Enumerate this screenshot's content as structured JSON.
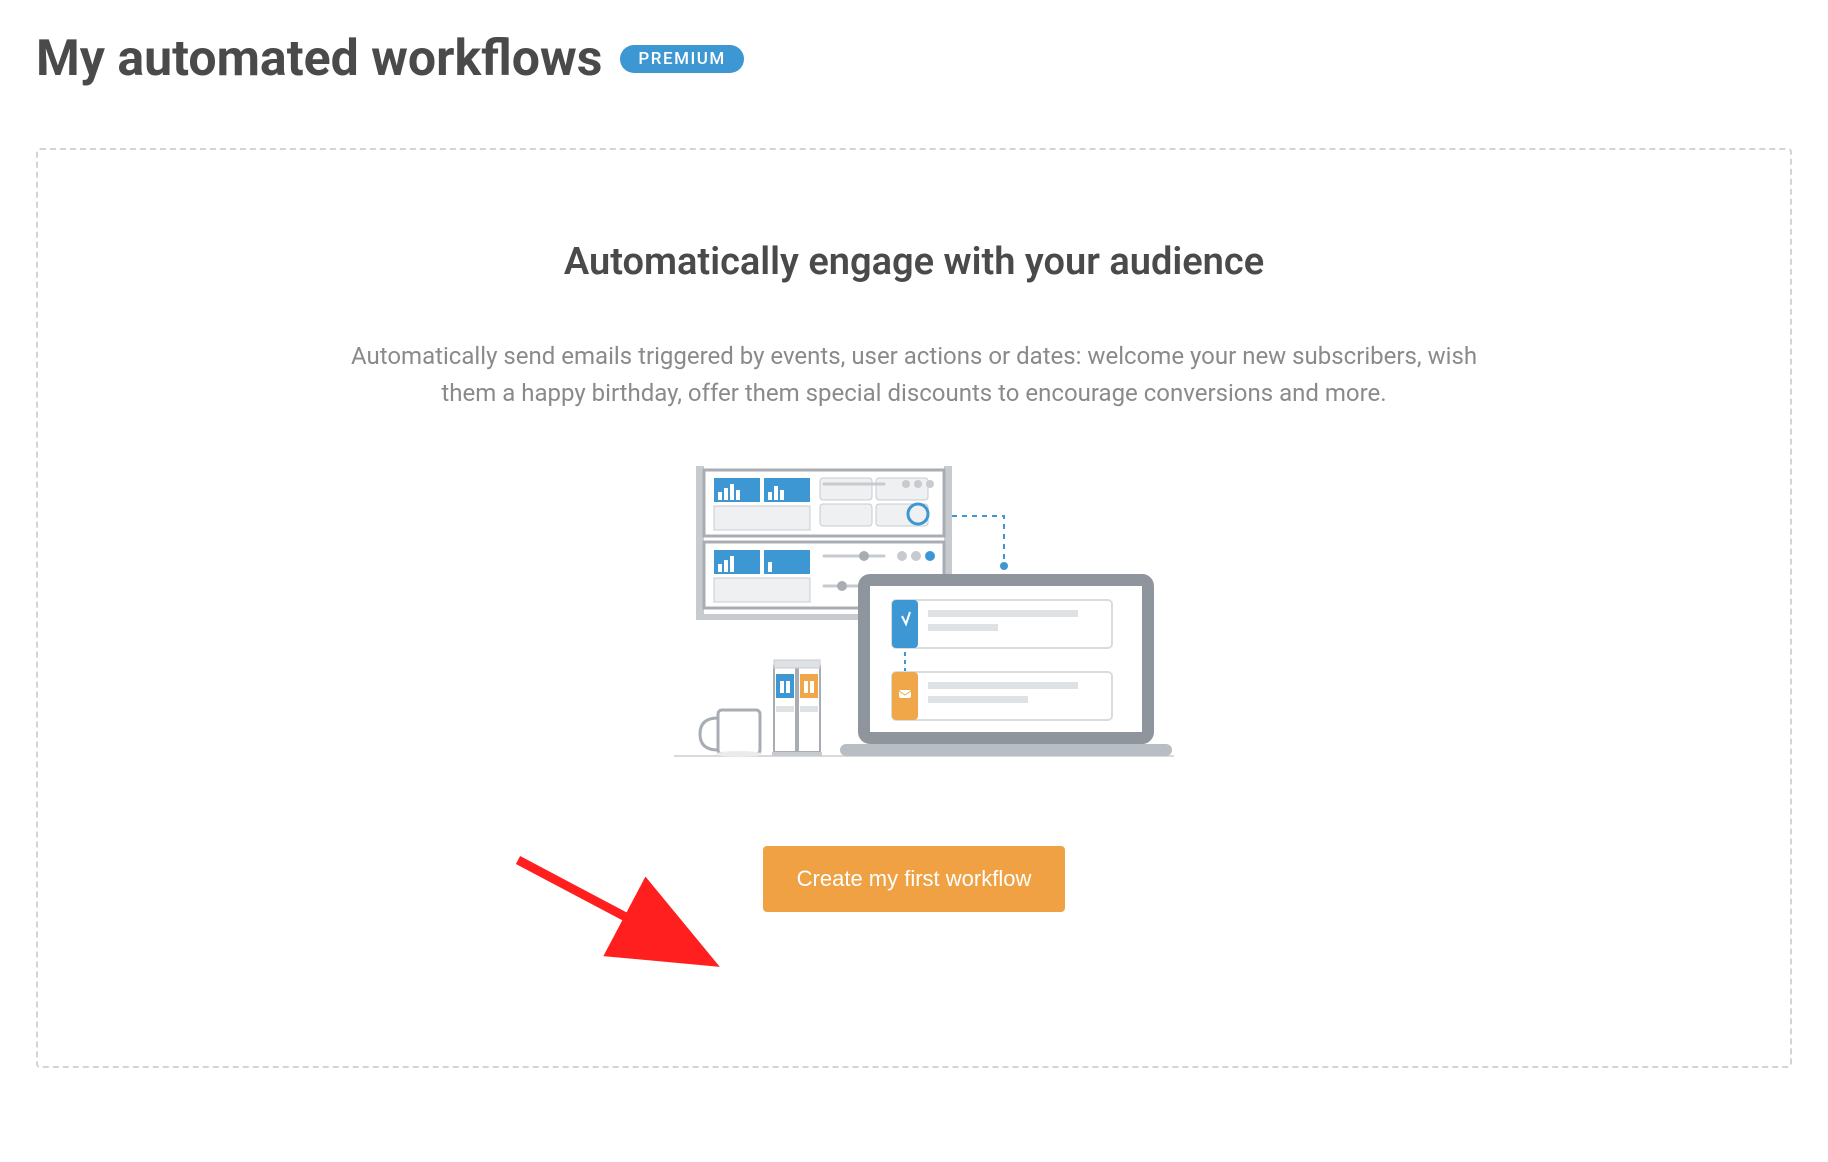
{
  "header": {
    "title": "My automated workflows",
    "badge": "PREMIUM"
  },
  "empty_state": {
    "heading": "Automatically engage with your audience",
    "description": "Automatically send emails triggered by events, user actions or dates: welcome your new subscribers, wish them a happy birthday, offer them special discounts to encourage conversions and more.",
    "cta_label": "Create my first workflow"
  },
  "colors": {
    "badge_bg": "#3c97d3",
    "cta_bg": "#efa144",
    "accent_blue": "#3c97d3",
    "accent_yellow": "#f0a74a",
    "illus_grey": "#a8adb3"
  },
  "annotation": {
    "arrow_points_to": "create-workflow-button"
  }
}
